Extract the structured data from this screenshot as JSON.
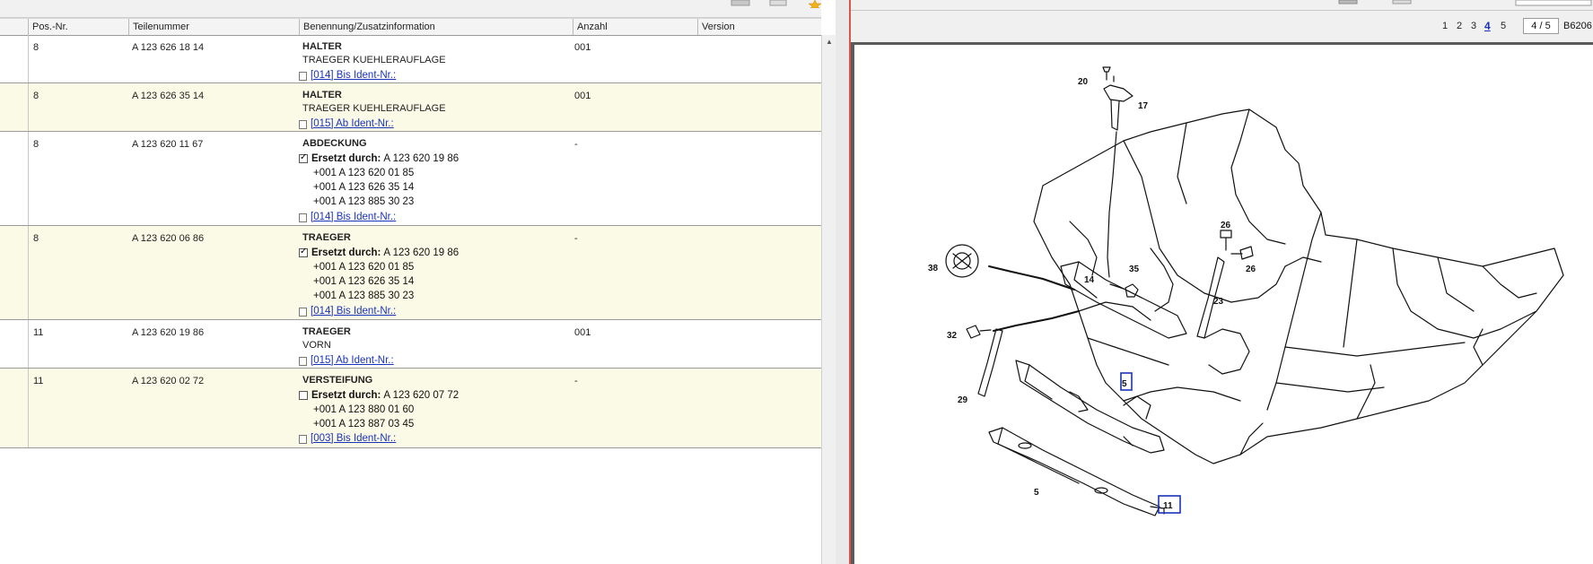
{
  "table": {
    "headers": {
      "pos": "Pos.-Nr.",
      "part": "Teilenummer",
      "desc": "Benennung/Zusatzinformation",
      "qty": "Anzahl",
      "version": "Version"
    },
    "rows": [
      {
        "pos": "8",
        "part": "A 123 626 18 14",
        "title": "HALTER",
        "sub": "TRAEGER KUEHLERAUFLAGE",
        "qty": "001",
        "ident": "[014] Bis Ident-Nr.:"
      },
      {
        "pos": "8",
        "part": "A 123 626 35 14",
        "title": "HALTER",
        "sub": "TRAEGER KUEHLERAUFLAGE",
        "qty": "001",
        "ident": "[015] Ab Ident-Nr.:"
      },
      {
        "pos": "8",
        "part": "A 123 620 11 67",
        "title": "ABDECKUNG",
        "qty": "-",
        "repl_label": "Ersetzt durch:",
        "repl_value": "A 123 620 19 86",
        "lines": [
          "+001 A 123 620 01 85",
          "+001 A 123 626 35 14",
          "+001 A 123 885 30 23"
        ],
        "ident": "[014] Bis Ident-Nr.:"
      },
      {
        "pos": "8",
        "part": "A 123 620 06 86",
        "title": "TRAEGER",
        "qty": "-",
        "repl_label": "Ersetzt durch:",
        "repl_value": "A 123 620 19 86",
        "lines": [
          "+001 A 123 620 01 85",
          "+001 A 123 626 35 14",
          "+001 A 123 885 30 23"
        ],
        "ident": "[014] Bis Ident-Nr.:"
      },
      {
        "pos": "11",
        "part": "A 123 620 19 86",
        "title": "TRAEGER",
        "sub": "VORN",
        "qty": "001",
        "ident": "[015] Ab Ident-Nr.:"
      },
      {
        "pos": "11",
        "part": "A 123 620 02 72",
        "title": "VERSTEIFUNG",
        "qty": "-",
        "repl_label": "Ersetzt durch:",
        "repl_value": "A 123 620 07 72",
        "lines": [
          "+001 A 123 880 01 60",
          "+001 A 123 887 03 45"
        ],
        "ident": "[003] Bis Ident-Nr.:"
      }
    ]
  },
  "viewer": {
    "pages": [
      "1",
      "2",
      "3",
      "4",
      "5"
    ],
    "current_page": "4",
    "page_counter": "4 / 5",
    "drawing_code": "B6206"
  },
  "diagram": {
    "callouts": [
      "20",
      "17",
      "38",
      "14",
      "35",
      "26",
      "26",
      "23",
      "32",
      "29",
      "5",
      "5",
      "11"
    ]
  },
  "colors": {
    "alt_row": "#fbfae6",
    "link": "#1a33b8",
    "highlight_box": "#1a33b8",
    "splitter_line": "#d9534f"
  }
}
